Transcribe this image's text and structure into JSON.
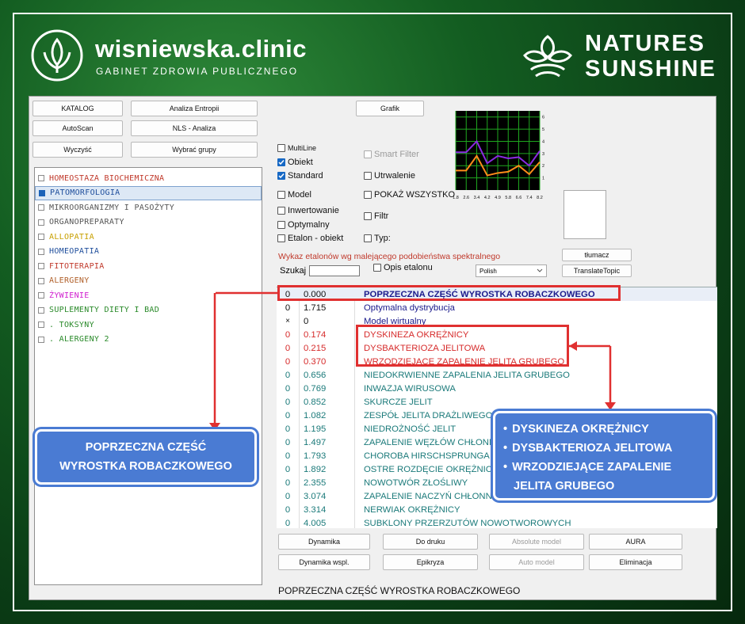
{
  "header": {
    "brand": "wisniewska.clinic",
    "subtitle": "GABINET ZDROWIA PUBLICZNEGO",
    "partner_line1": "NATURES",
    "partner_line2": "SUNSHINE"
  },
  "toolbar": {
    "katalog": "KATALOG",
    "analiza_entropii": "Analiza Entropii",
    "grafik": "Grafik",
    "autoscan": "AutoScan",
    "nls_analiza": "NLS - Analiza",
    "wyczysc": "Wyczyść",
    "wybrac_grupy": "Wybrać grupy"
  },
  "categories": [
    {
      "label": "HOMEOSTAZA BIOCHEMICZNA",
      "color": "#c0392b",
      "checked": false
    },
    {
      "label": "PATOMORFOLOGIA",
      "color": "#1f4e9c",
      "checked": true
    },
    {
      "label": "MIKROORGANIZMY I PASOŻYTY",
      "color": "#555555",
      "checked": false
    },
    {
      "label": "ORGANOPREPARATY",
      "color": "#555555",
      "checked": false
    },
    {
      "label": "ALLOPATIA",
      "color": "#c8a000",
      "checked": false
    },
    {
      "label": "HOMEOPATIA",
      "color": "#1f4e9c",
      "checked": false
    },
    {
      "label": "FITOTERAPIA",
      "color": "#c0392b",
      "checked": false
    },
    {
      "label": "ALERGENY",
      "color": "#b0602a",
      "checked": false
    },
    {
      "label": "ŻYWIENIE",
      "color": "#d01fcf",
      "checked": false
    },
    {
      "label": "SUPLEMENTY DIETY I BAD",
      "color": "#2a8a2a",
      "checked": false
    },
    {
      "label": ". TOKSYNY",
      "color": "#2a8a2a",
      "checked": false
    },
    {
      "label": ". ALERGENY 2",
      "color": "#2a8a2a",
      "checked": false
    }
  ],
  "options": {
    "multiline": "MultiLine",
    "obiekt": "Obiekt",
    "standard": "Standard",
    "smart_filter": "Smart Filter",
    "utrwalenie": "Utrwalenie",
    "model": "Model",
    "pokaz_wszystko": "POKAŻ WSZYSTKO",
    "inwertowanie": "Inwertowanie",
    "filtr": "Filtr",
    "optymalny": "Optymalny",
    "etalon_obiekt": "Etalon - obiekt",
    "typ": "Typ:"
  },
  "chart_data": {
    "type": "line",
    "x": [
      1.8,
      2.6,
      3.4,
      4.2,
      4.9,
      5.8,
      6.6,
      7.4,
      8.2
    ],
    "x_tick_labels": [
      "1.8",
      "2.6",
      "3.4",
      "4.2",
      "4.9",
      "5.8",
      "6.6",
      "7.4",
      "8.2"
    ],
    "y_tick_labels": [
      "6",
      "5",
      "4",
      "3",
      "2",
      "1"
    ],
    "ylim": [
      0,
      6.5
    ],
    "series": [
      {
        "color": "#8a2be2",
        "values": [
          3.1,
          3.1,
          4.0,
          2.2,
          2.8,
          2.6,
          2.7,
          2.0,
          3.2
        ]
      },
      {
        "color": "#ff8c1a",
        "values": [
          1.6,
          1.6,
          2.8,
          1.2,
          1.4,
          1.5,
          2.0,
          1.3,
          2.3
        ]
      }
    ]
  },
  "etalon_heading": "Wykaz etalonów wg malejącego podobieństwa spektralnego",
  "szukaj_label": "Szukaj",
  "szukaj_value": "",
  "opis_etalonu": "Opis etalonu",
  "language": "Polish",
  "tlumacz": "tłumacz",
  "translate_topic": "TranslateTopic",
  "results": [
    {
      "c0": "0",
      "c1": "0.000",
      "name": "POPRZECZNA CZĘŚĆ WYROSTKA ROBACZKOWEGO",
      "color": "#1a1a8c",
      "bold": true,
      "c0_color": "#111111",
      "c1_color": "#111111"
    },
    {
      "c0": "0",
      "c1": "1.715",
      "name": "Optymalna dystrybucja",
      "color": "#1a1a8c",
      "bold": false,
      "c0_color": "#111111",
      "c1_color": "#111111"
    },
    {
      "c0": "×",
      "c1": "0",
      "name": "Model wirtualny",
      "color": "#1a1a8c",
      "bold": false,
      "c0_color": "#111111",
      "c1_color": "#111111"
    },
    {
      "c0": "0",
      "c1": "0.174",
      "name": "DYSKINEZA OKRĘŻNICY",
      "color": "#d62b2b",
      "bold": false,
      "c0_color": "#d62b2b",
      "c1_color": "#d62b2b"
    },
    {
      "c0": "0",
      "c1": "0.215",
      "name": "DYSBAKTERIOZA JELITOWA",
      "color": "#d62b2b",
      "bold": false,
      "c0_color": "#d62b2b",
      "c1_color": "#d62b2b"
    },
    {
      "c0": "0",
      "c1": "0.370",
      "name": "WRZODZIEJĄCE ZAPALENIE JELITA GRUBEGO",
      "color": "#d62b2b",
      "bold": false,
      "c0_color": "#d62b2b",
      "c1_color": "#d62b2b"
    },
    {
      "c0": "0",
      "c1": "0.656",
      "name": "NIEDOKRWIENNE ZAPALENIA JELITA GRUBEGO",
      "color": "#1b7a7a",
      "bold": false,
      "c0_color": "#1b7a7a",
      "c1_color": "#1b7a7a"
    },
    {
      "c0": "0",
      "c1": "0.769",
      "name": "INWAZJA WIRUSOWA",
      "color": "#1b7a7a",
      "bold": false,
      "c0_color": "#1b7a7a",
      "c1_color": "#1b7a7a"
    },
    {
      "c0": "0",
      "c1": "0.852",
      "name": "SKURCZE JELIT",
      "color": "#1b7a7a",
      "bold": false,
      "c0_color": "#1b7a7a",
      "c1_color": "#1b7a7a"
    },
    {
      "c0": "0",
      "c1": "1.082",
      "name": "ZESPÓŁ JELITA DRAŻLIWEGO",
      "color": "#1b7a7a",
      "bold": false,
      "c0_color": "#1b7a7a",
      "c1_color": "#1b7a7a"
    },
    {
      "c0": "0",
      "c1": "1.195",
      "name": "NIEDROŻNOŚĆ JELIT",
      "color": "#1b7a7a",
      "bold": false,
      "c0_color": "#1b7a7a",
      "c1_color": "#1b7a7a"
    },
    {
      "c0": "0",
      "c1": "1.497",
      "name": "ZAPALENIE WĘZŁÓW CHŁONNYCH",
      "color": "#1b7a7a",
      "bold": false,
      "c0_color": "#1b7a7a",
      "c1_color": "#1b7a7a"
    },
    {
      "c0": "0",
      "c1": "1.793",
      "name": "CHOROBA HIRSCHSPRUNGA",
      "color": "#1b7a7a",
      "bold": false,
      "c0_color": "#1b7a7a",
      "c1_color": "#1b7a7a"
    },
    {
      "c0": "0",
      "c1": "1.892",
      "name": "OSTRE ROZDĘCIE OKRĘŻNICY",
      "color": "#1b7a7a",
      "bold": false,
      "c0_color": "#1b7a7a",
      "c1_color": "#1b7a7a"
    },
    {
      "c0": "0",
      "c1": "2.355",
      "name": "NOWOTWÓR ZŁOŚLIWY",
      "color": "#1b7a7a",
      "bold": false,
      "c0_color": "#1b7a7a",
      "c1_color": "#1b7a7a"
    },
    {
      "c0": "0",
      "c1": "3.074",
      "name": "ZAPALENIE NACZYŃ CHŁONNYCH",
      "color": "#1b7a7a",
      "bold": false,
      "c0_color": "#1b7a7a",
      "c1_color": "#1b7a7a"
    },
    {
      "c0": "0",
      "c1": "3.314",
      "name": "NERWIAK OKRĘŻNICY",
      "color": "#1b7a7a",
      "bold": false,
      "c0_color": "#1b7a7a",
      "c1_color": "#1b7a7a"
    },
    {
      "c0": "0",
      "c1": "4.005",
      "name": "SUBKLONY PRZERZUTÓW NOWOTWOROWYCH",
      "color": "#1b7a7a",
      "bold": false,
      "c0_color": "#1b7a7a",
      "c1_color": "#1b7a7a"
    }
  ],
  "bottom_buttons": {
    "dynamika": "Dynamika",
    "do_druku": "Do druku",
    "absolute_model": "Absolute model",
    "aura": "AURA",
    "dynamika_wspl": "Dynamika wspl.",
    "epikryza": "Epikryza",
    "auto_model": "Auto model",
    "eliminacja": "Eliminacja"
  },
  "status_text": "POPRZECZNA CZĘŚĆ WYROSTKA ROBACZKOWEGO",
  "callout_left": {
    "line1": "POPRZECZNA CZĘŚĆ",
    "line2": "WYROSTKA ROBACZKOWEGO"
  },
  "callout_right": {
    "items": [
      "DYSKINEZA OKRĘŻNICY",
      "DYSBAKTERIOZA JELITOWA",
      "WRZODZIEJĄCE ZAPALENIE",
      "JELITA GRUBEGO"
    ]
  },
  "colors": {
    "highlight_red": "#e03030",
    "callout_blue": "#4a7bd3"
  }
}
